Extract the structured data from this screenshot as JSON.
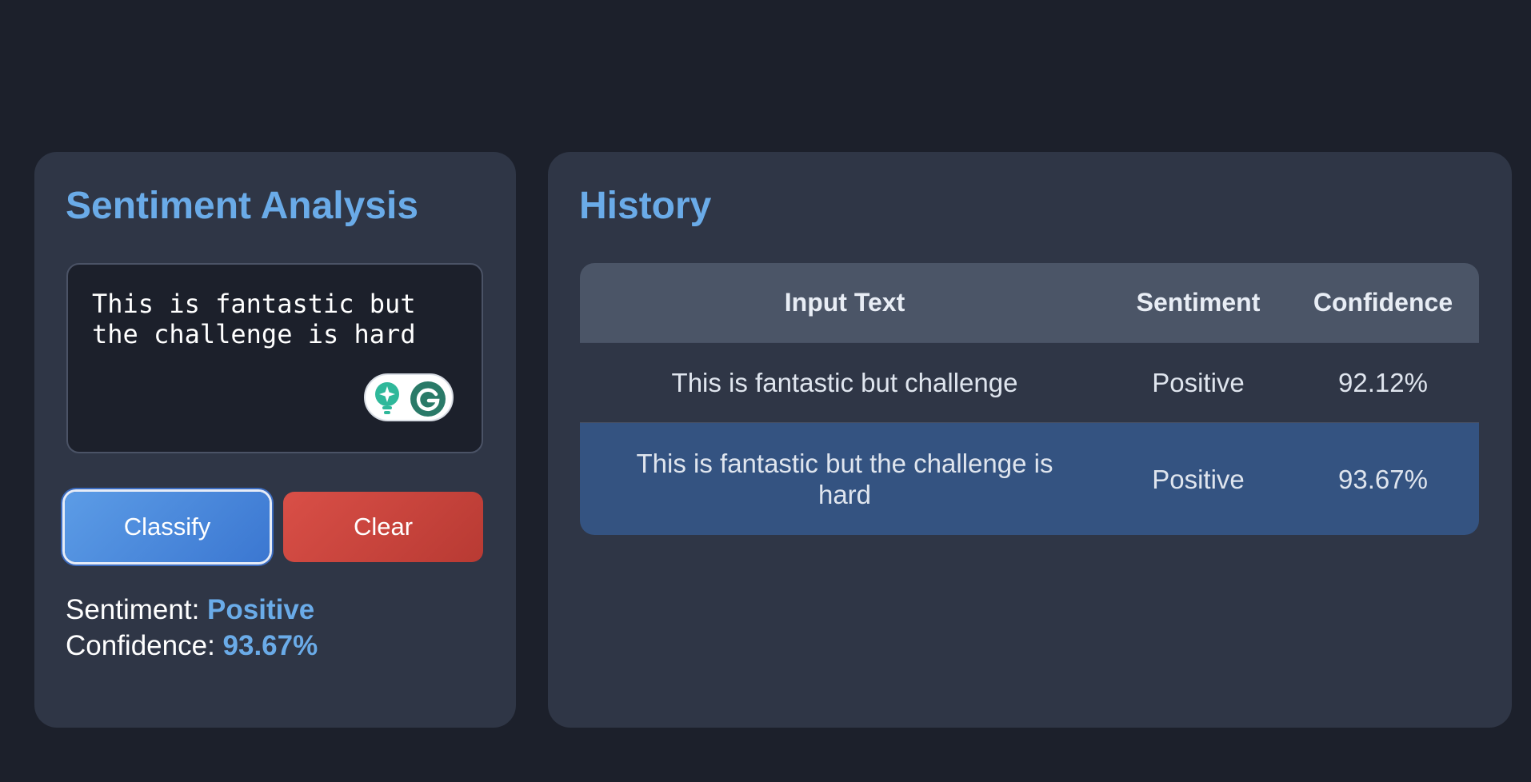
{
  "sentiment_panel": {
    "title": "Sentiment Analysis",
    "input_value": "This is fantastic but\nthe challenge is hard",
    "classify_label": "Classify",
    "clear_label": "Clear",
    "sentiment_label": "Sentiment: ",
    "sentiment_value": "Positive",
    "confidence_label": "Confidence: ",
    "confidence_value": "93.67%"
  },
  "grammarly_widget": {
    "icons": [
      "lightbulb-icon",
      "grammarly-g-icon"
    ]
  },
  "history_panel": {
    "title": "History",
    "columns": [
      "Input Text",
      "Sentiment",
      "Confidence"
    ],
    "rows": [
      {
        "text": "This is fantastic but challenge",
        "sentiment": "Positive",
        "confidence": "92.12%"
      },
      {
        "text": "This is fantastic but the challenge is hard",
        "sentiment": "Positive",
        "confidence": "93.67%"
      }
    ]
  },
  "colors": {
    "background": "#1c202b",
    "card": "#2f3646",
    "accent": "#6aabe8",
    "classify": "#4a88dc",
    "clear": "#cc4740",
    "selected_row": "#345381"
  }
}
